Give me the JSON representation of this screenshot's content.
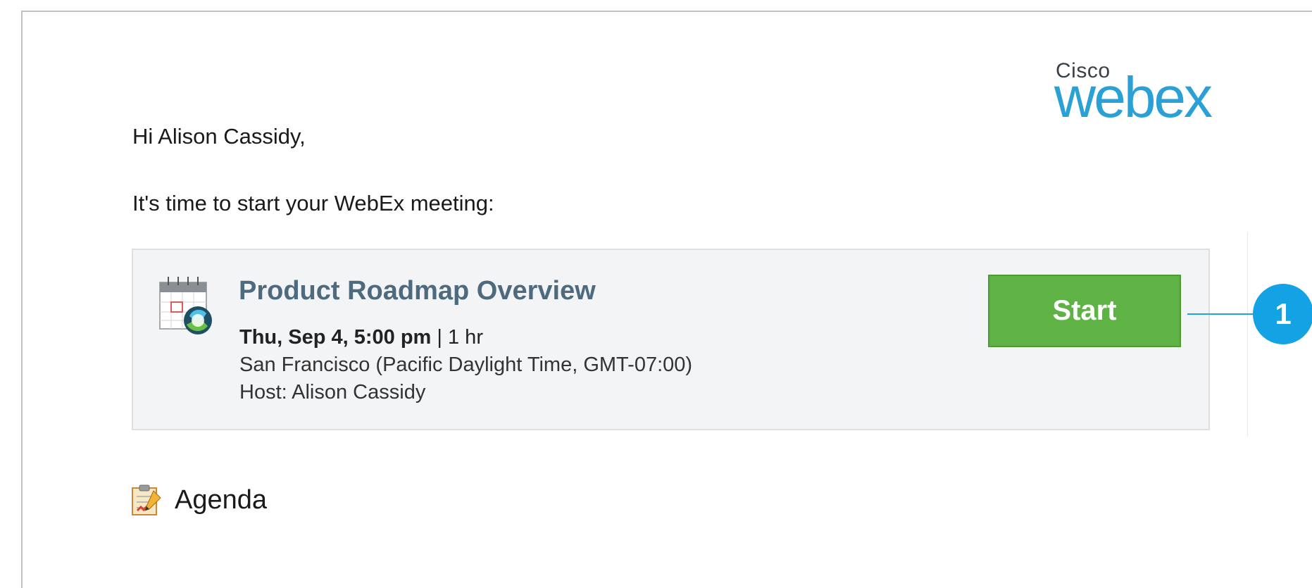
{
  "brand": {
    "small": "Cisco",
    "big": "webex"
  },
  "email": {
    "greeting": "Hi Alison Cassidy,",
    "intro": "It's time to start your WebEx meeting:"
  },
  "meeting": {
    "title": "Product Roadmap Overview",
    "datetime": "Thu, Sep 4, 5:00 pm",
    "separator": " | ",
    "duration": "1 hr",
    "location": "San Francisco (Pacific Daylight Time, GMT-07:00)",
    "host": "Host: Alison Cassidy",
    "start_label": "Start"
  },
  "callout": {
    "number": "1"
  },
  "agenda": {
    "label": "Agenda"
  },
  "colors": {
    "accent_blue": "#2aa1d6",
    "start_green": "#5fb244",
    "title_slate": "#4d6a7e",
    "callout_blue": "#13a2e4"
  },
  "icons": {
    "meeting": "calendar-webex-icon",
    "agenda": "notepad-pencil-icon"
  }
}
